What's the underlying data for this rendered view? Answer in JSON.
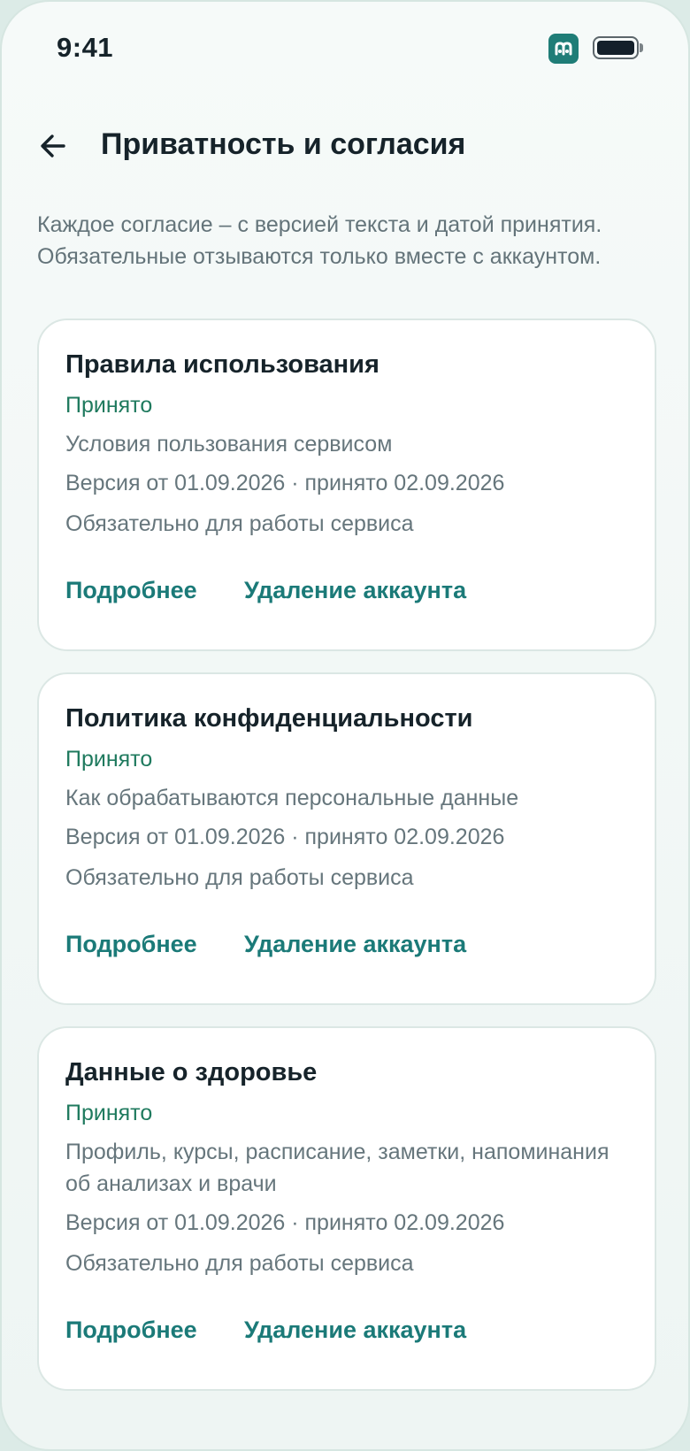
{
  "status_bar": {
    "time": "9:41",
    "app_icon": "app-badge-icon",
    "battery_icon": "battery-icon"
  },
  "header": {
    "back_icon": "arrow-left-icon",
    "title": "Приватность и согласия"
  },
  "intro": "Каждое согласие – с версией текста и датой принятия. Обязательные отзываются только вместе с аккаунтом.",
  "colors": {
    "accent": "#1b7a78",
    "status_accepted": "#1f7a5e",
    "text_primary": "#16232a",
    "text_secondary": "#66767c"
  },
  "consents": [
    {
      "title": "Правила использования",
      "status": "Принято",
      "description": "Условия пользования сервисом",
      "version": "Версия от 01.09.2026 · принято 02.09.2026",
      "required_note": "Обязательно для работы сервиса",
      "details_label": "Подробнее",
      "delete_label": "Удаление аккаунта"
    },
    {
      "title": "Политика конфиденциальности",
      "status": "Принято",
      "description": "Как обрабатываются персональные данные",
      "version": "Версия от 01.09.2026 · принято 02.09.2026",
      "required_note": "Обязательно для работы сервиса",
      "details_label": "Подробнее",
      "delete_label": "Удаление аккаунта"
    },
    {
      "title": "Данные о здоровье",
      "status": "Принято",
      "description": "Профиль, курсы, расписание, заметки, напоминания об анализах и врачи",
      "version": "Версия от 01.09.2026 · принято 02.09.2026",
      "required_note": "Обязательно для работы сервиса",
      "details_label": "Подробнее",
      "delete_label": "Удаление аккаунта"
    }
  ]
}
